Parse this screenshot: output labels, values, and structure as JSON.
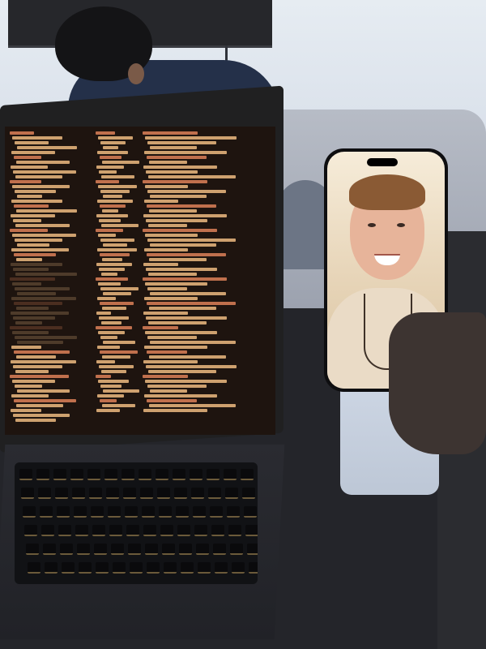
{
  "scene": {
    "description_keys": [
      "laptop",
      "phone",
      "person"
    ],
    "colors": {
      "wall": "#e1e7ef",
      "sofa": "#a7adb9",
      "code_text": "#e1b07a",
      "code_text_alt": "#d27a54",
      "phone_background": "#f2e4cc"
    }
  },
  "icons": {
    "laptop": "laptop-icon",
    "phone": "phone-icon"
  }
}
